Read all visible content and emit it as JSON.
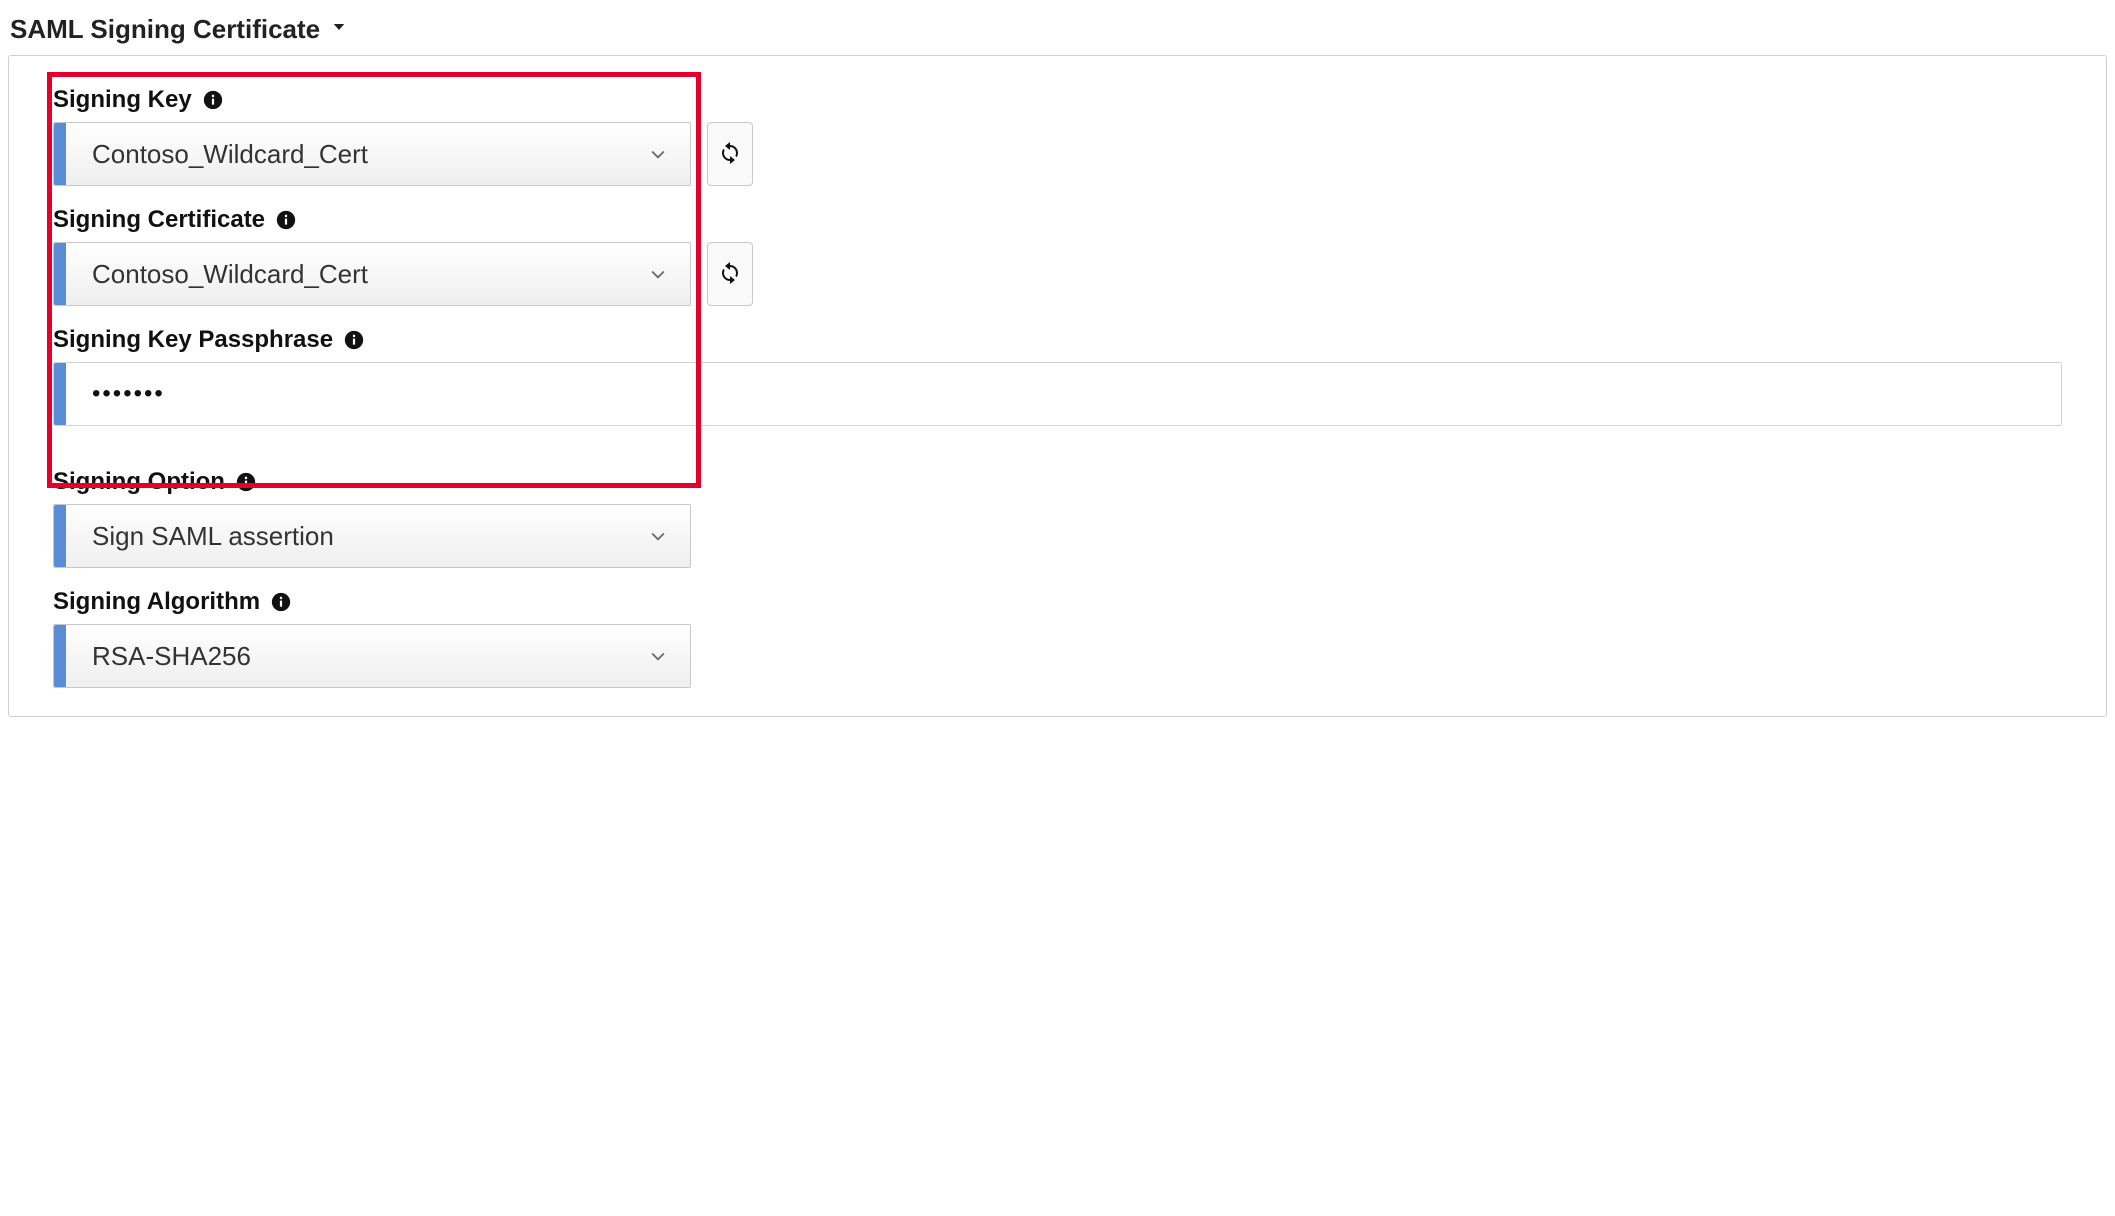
{
  "section": {
    "title": "SAML Signing Certificate"
  },
  "fields": {
    "signingKey": {
      "label": "Signing Key",
      "value": "Contoso_Wildcard_Cert"
    },
    "signingCertificate": {
      "label": "Signing Certificate",
      "value": "Contoso_Wildcard_Cert"
    },
    "signingKeyPassphrase": {
      "label": "Signing Key Passphrase",
      "value": "•••••••"
    },
    "signingOption": {
      "label": "Signing Option",
      "value": "Sign SAML assertion"
    },
    "signingAlgorithm": {
      "label": "Signing Algorithm",
      "value": "RSA-SHA256"
    }
  }
}
